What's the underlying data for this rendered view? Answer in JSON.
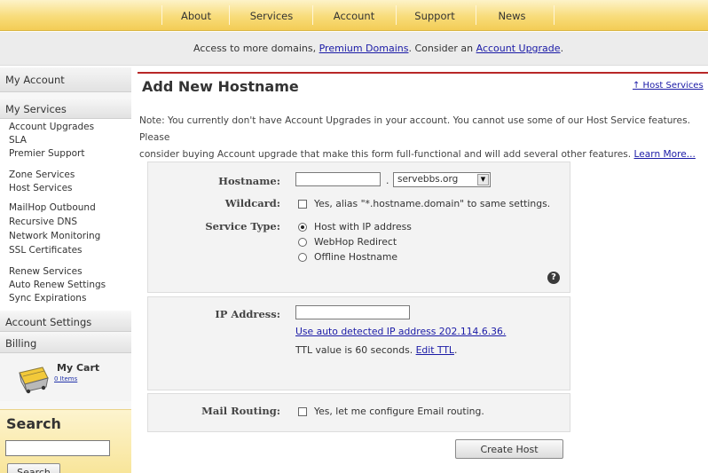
{
  "nav": {
    "items": [
      "About",
      "Services",
      "Account",
      "Support",
      "News"
    ]
  },
  "notice": {
    "prefix": "Access to more domains, ",
    "link1": "Premium Domains",
    "middle": ". Consider an ",
    "link2": "Account Upgrade",
    "suffix": "."
  },
  "sidebar": {
    "my_account": "My Account",
    "my_services": "My Services",
    "group1": [
      "Account Upgrades",
      "SLA",
      "Premier Support"
    ],
    "group2": [
      "Zone Services",
      "Host Services"
    ],
    "group3": [
      "MailHop Outbound",
      "Recursive DNS",
      "Network Monitoring",
      "SSL Certificates"
    ],
    "group4": [
      "Renew Services",
      "Auto Renew Settings",
      "Sync Expirations"
    ],
    "account_settings": "Account Settings",
    "billing": "Billing",
    "cart_title": "My Cart",
    "cart_items": "0 Items",
    "search_title": "Search",
    "search_button": "Search",
    "search_value": ""
  },
  "main": {
    "title": "Add New Hostname",
    "host_services_link": "↑ Host Services",
    "note_line1": "Note: You currently don't have Account Upgrades in your account. You cannot use some of our Host Service features. Please",
    "note_line2": "consider buying Account upgrade that make this form full-functional and will add several other features. ",
    "learn_more": "Learn More...",
    "hostname_label": "Hostname:",
    "hostname_value": "",
    "dot": ".",
    "domain_selected": "servebbs.org",
    "wildcard_label": "Wildcard:",
    "wildcard_text": "Yes, alias \"*.hostname.domain\" to same settings.",
    "service_type_label": "Service Type:",
    "service_options": [
      "Host with IP address",
      "WebHop Redirect",
      "Offline Hostname"
    ],
    "service_selected": "Host with IP address",
    "ip_label": "IP Address:",
    "ip_value": "",
    "auto_ip_link": "Use auto detected IP address 202.114.6.36.",
    "ttl_text": "TTL value is 60 seconds. ",
    "ttl_link": "Edit TTL",
    "ttl_period": ".",
    "mail_label": "Mail Routing:",
    "mail_text": "Yes, let me configure Email routing.",
    "create_button": "Create Host"
  },
  "colors": {
    "accent_rule": "#b82828",
    "nav_gold": "#f8dc7a",
    "link": "#1a1aa6"
  }
}
